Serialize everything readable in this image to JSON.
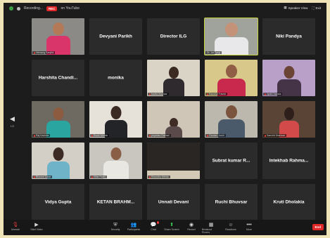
{
  "topbar": {
    "recording_text": "Recording...",
    "rec_badge": "REC",
    "host_text": "on YouTube",
    "speaker_view": "Speaker View",
    "exit_fullscreen": "Exit"
  },
  "tiles": {
    "t00": "Hemang Kanjikli",
    "t01": "Devyani Parikh",
    "t02": "Director ILG",
    "t03": "Dr. Jai Tyagi",
    "t04": "Niki Pandya",
    "t10": "Harshita  Chandi...",
    "t11": "monika",
    "t12": "kavita bhavsar",
    "t13": "Kaushal Trivedi",
    "t14": "Jyoti Chanda",
    "t20": "Raj Kachda",
    "t21": "Ruchi Mehta",
    "t22": "priyanka Rathod",
    "t23": "Gautam Joshi",
    "t24": "Sanchit Jhanwar",
    "t30": "Bhoomi Dave",
    "t31": "Mihir Patel",
    "t32": "Khushbu Mehta",
    "t33": "Subrat kumar R...",
    "t34": "Intekhab Rahma...",
    "t40": "Vidya Gupta",
    "t41": "KETAN  BRAHM...",
    "t42": "Unnati Devani",
    "t43": "Ruchi Bhuvsar",
    "t44": "Kruti Dholakia"
  },
  "leftnav": {
    "arrow": "◀",
    "page": "1/2"
  },
  "toolbar": {
    "unmute": "Unmute",
    "start_video": "Start Video",
    "security": "Security",
    "participants": "Participants",
    "participants_count": "25",
    "chat": "Chat",
    "share": "Share Screen",
    "record": "Record",
    "breakout": "Breakout Rooms",
    "reactions": "Reactions",
    "more": "More",
    "end": "End"
  },
  "colors": {
    "active_border": "#c5d23a",
    "end_red": "#e02828",
    "share_green": "#3ccf5c"
  }
}
